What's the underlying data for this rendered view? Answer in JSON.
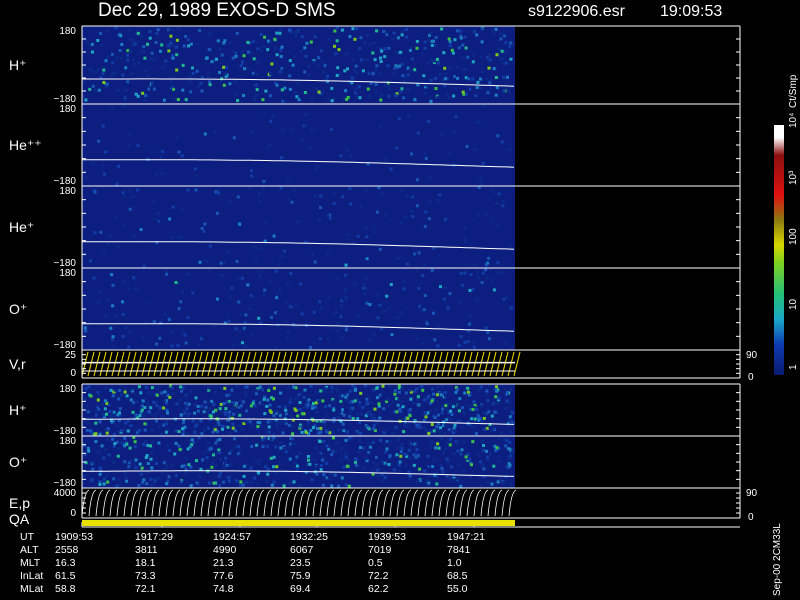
{
  "header": {
    "title": "Dec 29, 1989   EXOS-D SMS",
    "file": "s9122906.esr",
    "time": "19:09:53"
  },
  "colorbar": {
    "unit": "Ct/Smp",
    "labels": [
      "1",
      "10",
      "100",
      "10³",
      "10⁴"
    ],
    "stops": [
      "#0a1a70",
      "#0d3ab0",
      "#1aa6c8",
      "#22c07a",
      "#7fd020",
      "#d8d800",
      "#8b7a10",
      "#e01010",
      "#8b1010",
      "#ffffff"
    ]
  },
  "panels": [
    {
      "id": "h-plus-1",
      "label": "H⁺",
      "ymax": "180",
      "ymin": "−180"
    },
    {
      "id": "he-pp",
      "label": "He⁺⁺",
      "ymax": "180",
      "ymin": "−180"
    },
    {
      "id": "he-plus",
      "label": "He⁺",
      "ymax": "180",
      "ymin": "−180"
    },
    {
      "id": "o-plus-1",
      "label": "O⁺",
      "ymax": "180",
      "ymin": "−180"
    },
    {
      "id": "vr",
      "label": "V,r",
      "ymax": "25",
      "ymin": "0",
      "rmax": "90",
      "rmin": "0"
    },
    {
      "id": "h-plus-2",
      "label": "H⁺",
      "ymax": "180",
      "ymin": "−180"
    },
    {
      "id": "o-plus-2",
      "label": "O⁺",
      "ymax": "180",
      "ymin": "−180"
    },
    {
      "id": "ep",
      "label": "E,p",
      "ymax": "4000",
      "ymin": "0",
      "rmax": "90",
      "rmin": "0"
    }
  ],
  "qa_label": "QA",
  "ephemeris": {
    "rows": [
      {
        "name": "UT",
        "values": [
          "1909:53",
          "1917:29",
          "1924:57",
          "1932:25",
          "1939:53",
          "1947:21"
        ]
      },
      {
        "name": "ALT",
        "values": [
          "2558",
          "3811",
          "4990",
          "6067",
          "7019",
          "7841"
        ]
      },
      {
        "name": "MLT",
        "values": [
          "16.3",
          "18.1",
          "21.3",
          "23.5",
          "0.5",
          "1.0"
        ]
      },
      {
        "name": "InLat",
        "values": [
          "61.5",
          "73.3",
          "77.6",
          "75.9",
          "72.2",
          "68.5"
        ]
      },
      {
        "name": "MLat",
        "values": [
          "58.8",
          "72.1",
          "74.8",
          "69.4",
          "62.2",
          "55.0"
        ]
      }
    ]
  },
  "side_note": "Sep-00 2CM33L",
  "chart_data": {
    "type": "heatmap",
    "title": "Dec 29, 1989   EXOS-D SMS",
    "x_ticks": [
      "1909:53",
      "1917:29",
      "1924:57",
      "1932:25",
      "1939:53",
      "1947:21"
    ],
    "series": [
      {
        "name": "H⁺",
        "ylim": [
          -180,
          180
        ]
      },
      {
        "name": "He⁺⁺",
        "ylim": [
          -180,
          180
        ]
      },
      {
        "name": "He⁺",
        "ylim": [
          -180,
          180
        ]
      },
      {
        "name": "O⁺",
        "ylim": [
          -180,
          180
        ]
      },
      {
        "name": "V,r",
        "ylim": [
          0,
          25
        ]
      },
      {
        "name": "H⁺",
        "ylim": [
          -180,
          180
        ]
      },
      {
        "name": "O⁺",
        "ylim": [
          -180,
          180
        ]
      },
      {
        "name": "E,p",
        "ylim": [
          0,
          4000
        ]
      }
    ],
    "color_scale": "log",
    "color_labels": [
      "1",
      "10",
      "100",
      "10³",
      "10⁴"
    ]
  }
}
